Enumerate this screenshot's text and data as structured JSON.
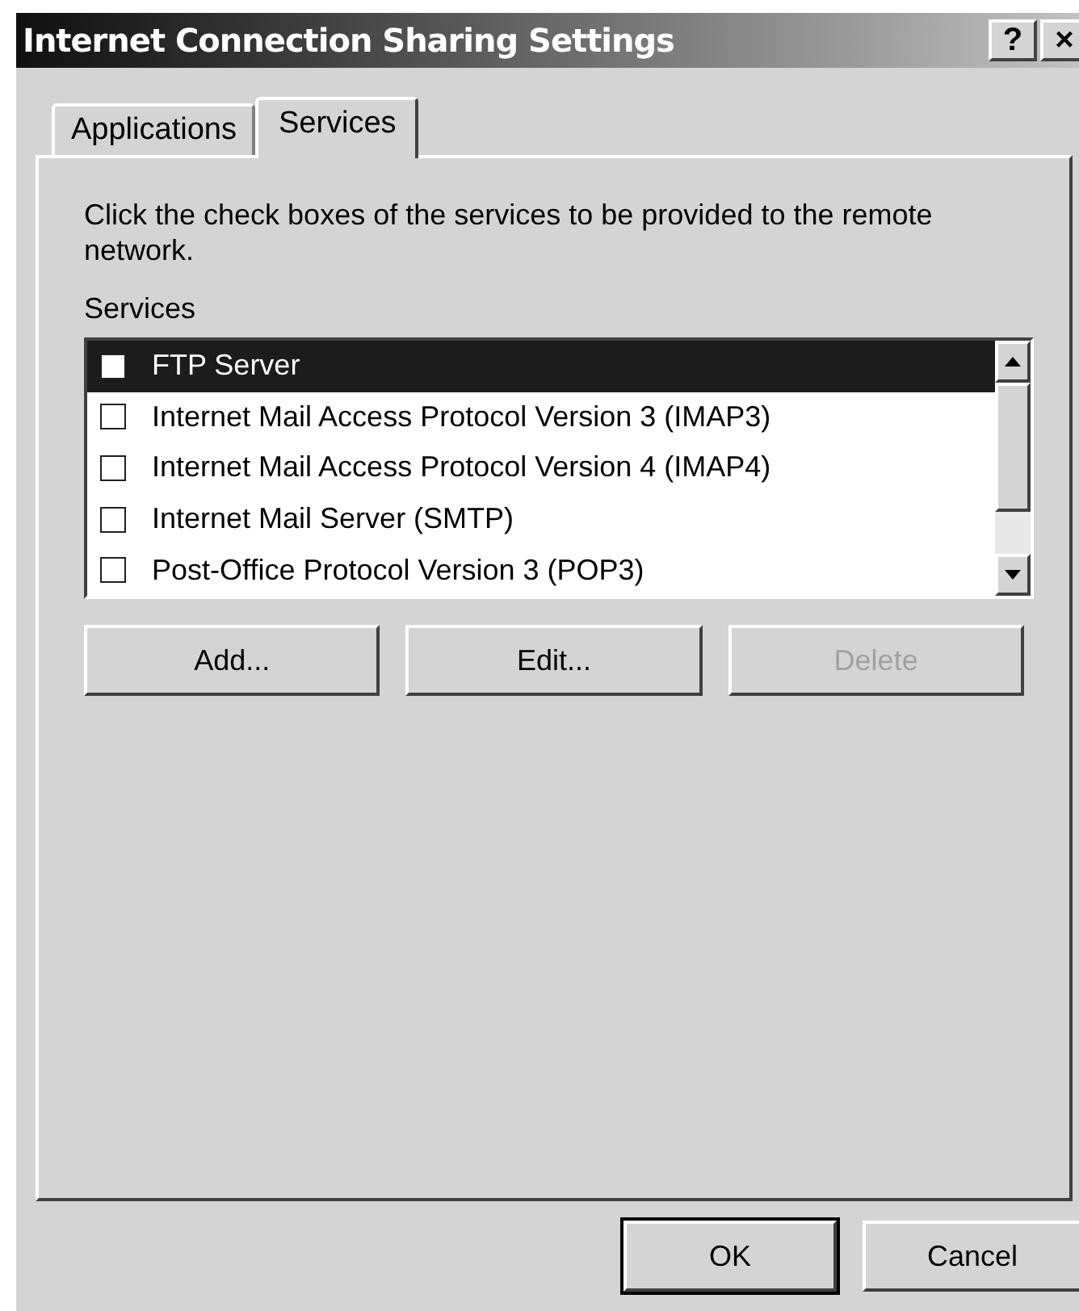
{
  "window": {
    "title": "Internet Connection Sharing Settings",
    "title_buttons": [
      "?",
      "×"
    ]
  },
  "tabs": [
    {
      "label": "Applications",
      "selected": false
    },
    {
      "label": "Services",
      "selected": true
    }
  ],
  "instructions": "Click the check boxes of the services to be provided to the remote network.",
  "services": {
    "label": "Services",
    "items": [
      {
        "label": "FTP Server",
        "checked": false,
        "selected": true
      },
      {
        "label": "Internet Mail Access Protocol Version 3 (IMAP3)",
        "checked": false,
        "selected": false
      },
      {
        "label": "Internet Mail Access Protocol Version 4 (IMAP4)",
        "checked": false,
        "selected": false
      },
      {
        "label": "Internet Mail Server (SMTP)",
        "checked": false,
        "selected": false
      },
      {
        "label": "Post-Office Protocol Version 3 (POP3)",
        "checked": false,
        "selected": false
      }
    ]
  },
  "list_buttons": [
    {
      "label": "Add...",
      "disabled": false
    },
    {
      "label": "Edit...",
      "disabled": false
    },
    {
      "label": "Delete",
      "disabled": true
    }
  ],
  "dialog_buttons": [
    {
      "label": "OK",
      "default": true
    },
    {
      "label": "Cancel",
      "default": false
    }
  ]
}
